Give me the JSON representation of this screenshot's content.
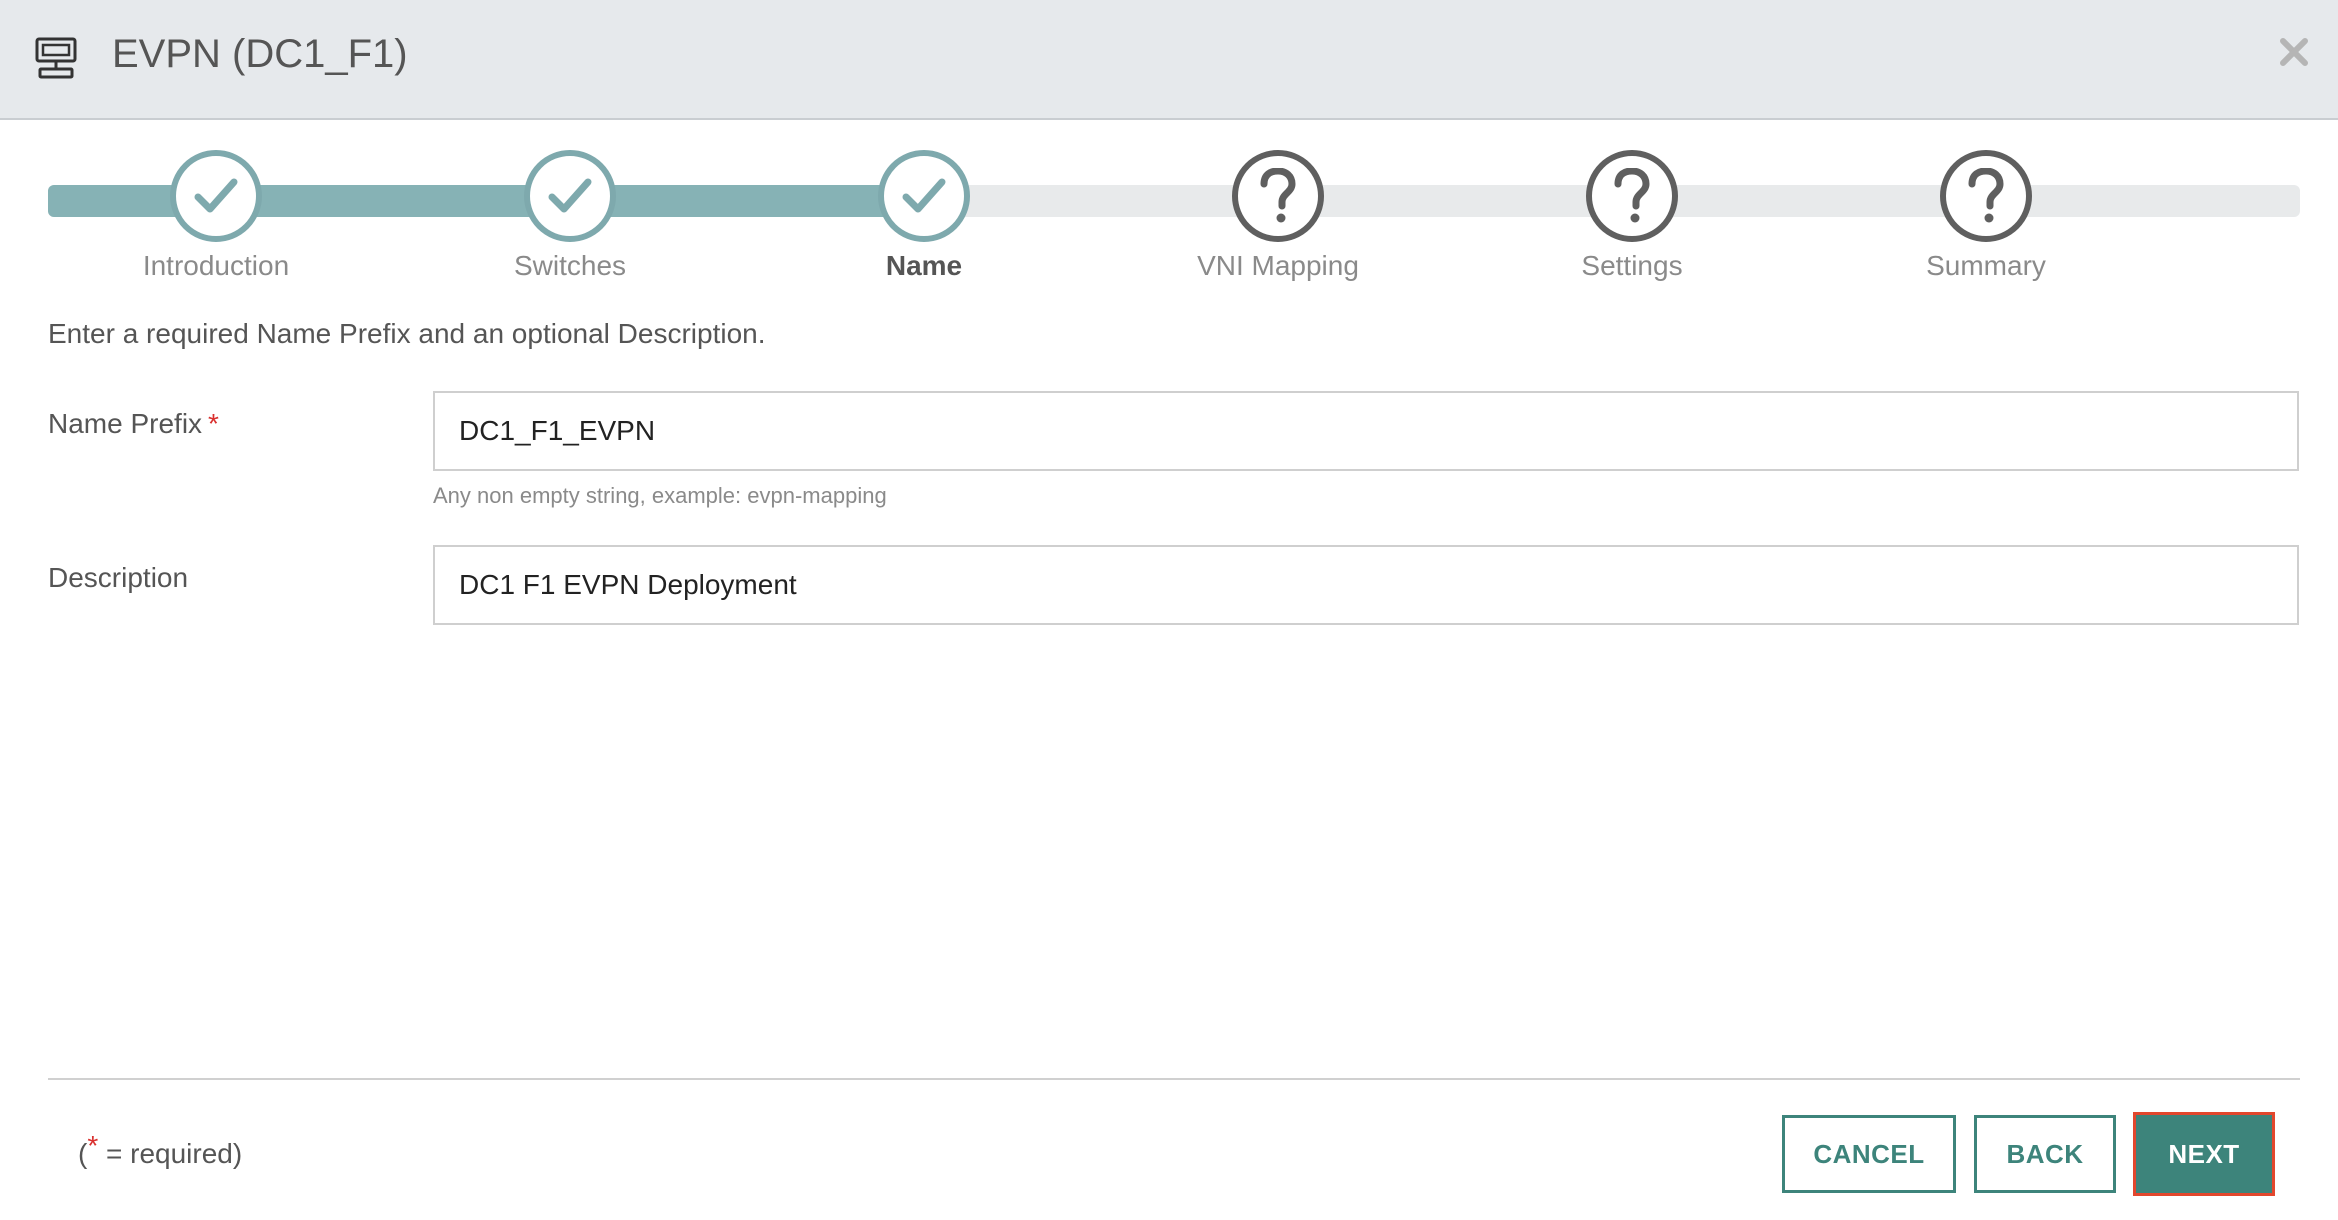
{
  "header": {
    "title": "EVPN (DC1_F1)",
    "app_icon": "network-device-icon",
    "close_icon": "close-icon"
  },
  "stepper": {
    "steps": [
      {
        "label": "Introduction",
        "status": "complete",
        "icon": "check-icon"
      },
      {
        "label": "Switches",
        "status": "complete",
        "icon": "check-icon"
      },
      {
        "label": "Name",
        "status": "current",
        "icon": "check-icon"
      },
      {
        "label": "VNI Mapping",
        "status": "pending",
        "icon": "question-icon"
      },
      {
        "label": "Settings",
        "status": "pending",
        "icon": "question-icon"
      },
      {
        "label": "Summary",
        "status": "pending",
        "icon": "question-icon"
      }
    ]
  },
  "form": {
    "instructions": "Enter a required Name Prefix and an optional Description.",
    "name_prefix": {
      "label": "Name Prefix",
      "required_mark": "*",
      "value": "DC1_F1_EVPN",
      "hint": "Any non empty string, example: evpn-mapping"
    },
    "description": {
      "label": "Description",
      "value": "DC1 F1 EVPN Deployment"
    }
  },
  "footer": {
    "required_note_open": "(",
    "required_note_star": "*",
    "required_note_rest": " = required)",
    "buttons": {
      "cancel": "CANCEL",
      "back": "BACK",
      "next": "NEXT"
    }
  },
  "colors": {
    "accent": "#3d847b",
    "progress_fill": "#86b2b5",
    "required": "#d9302e",
    "focus_outline": "#e2472d"
  }
}
